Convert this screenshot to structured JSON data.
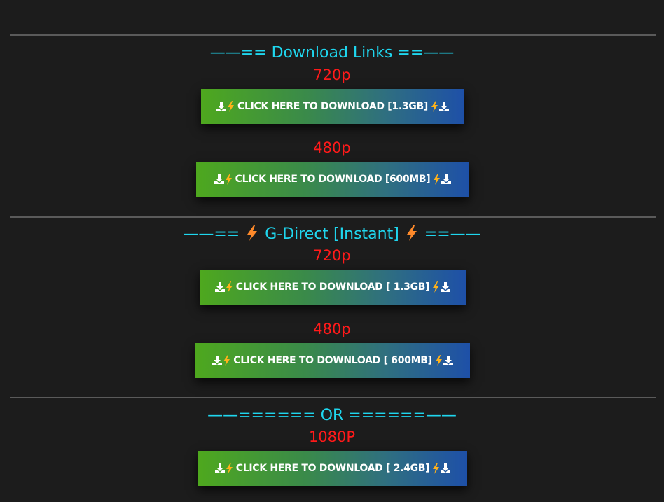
{
  "sections": {
    "download_links": {
      "heading_left": "——== Download Links ==——",
      "groups": [
        {
          "quality": "720p",
          "button": "CLICK HERE TO DOWNLOAD [1.3GB]"
        },
        {
          "quality": "480p",
          "button": "CLICK HERE TO DOWNLOAD [600MB]"
        }
      ]
    },
    "g_direct": {
      "heading_prefix": "——==",
      "heading_text": "G-Direct [Instant]",
      "heading_suffix": "==——",
      "groups": [
        {
          "quality": "720p",
          "button": "CLICK HERE TO DOWNLOAD [ 1.3GB]"
        },
        {
          "quality": "480p",
          "button": "CLICK HERE TO DOWNLOAD [ 600MB]"
        }
      ]
    },
    "or_section": {
      "heading": "——====== OR ======——",
      "groups": [
        {
          "quality": "1080P",
          "button": "CLICK HERE TO DOWNLOAD [ 2.4GB]"
        }
      ]
    }
  },
  "colors": {
    "background": "#1c1c1c",
    "heading": "#1fd6ee",
    "quality": "#ff1a1a",
    "bolt": "#ff8a2a",
    "button_gradient_start": "#4ea81e",
    "button_gradient_end": "#1e50a8"
  },
  "icons": {
    "button_left": [
      "download-icon",
      "lightning-bolt-icon"
    ],
    "button_right": [
      "lightning-bolt-icon",
      "download-icon"
    ],
    "heading_bolt": "lightning-bolt-icon"
  }
}
